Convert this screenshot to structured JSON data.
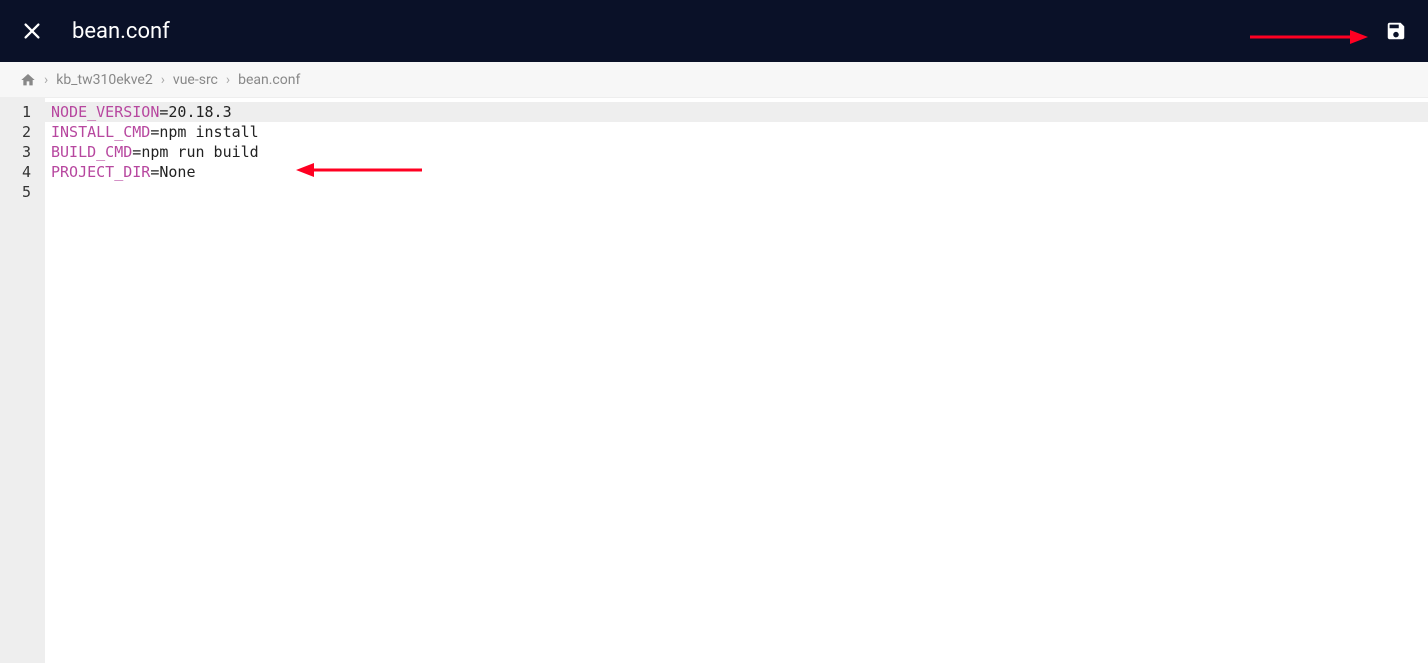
{
  "header": {
    "filename": "bean.conf"
  },
  "breadcrumb": {
    "items": [
      "kb_tw310ekve2",
      "vue-src",
      "bean.conf"
    ]
  },
  "editor": {
    "lines": [
      {
        "num": "1",
        "key": "NODE_VERSION",
        "eq": "=",
        "val": "20.18.3"
      },
      {
        "num": "2",
        "key": "INSTALL_CMD",
        "eq": "=",
        "val": "npm install"
      },
      {
        "num": "3",
        "key": "BUILD_CMD",
        "eq": "=",
        "val": "npm run build"
      },
      {
        "num": "4",
        "key": "PROJECT_DIR",
        "eq": "=",
        "val": "None"
      },
      {
        "num": "5",
        "key": "",
        "eq": "",
        "val": ""
      }
    ],
    "active_line": 0
  }
}
